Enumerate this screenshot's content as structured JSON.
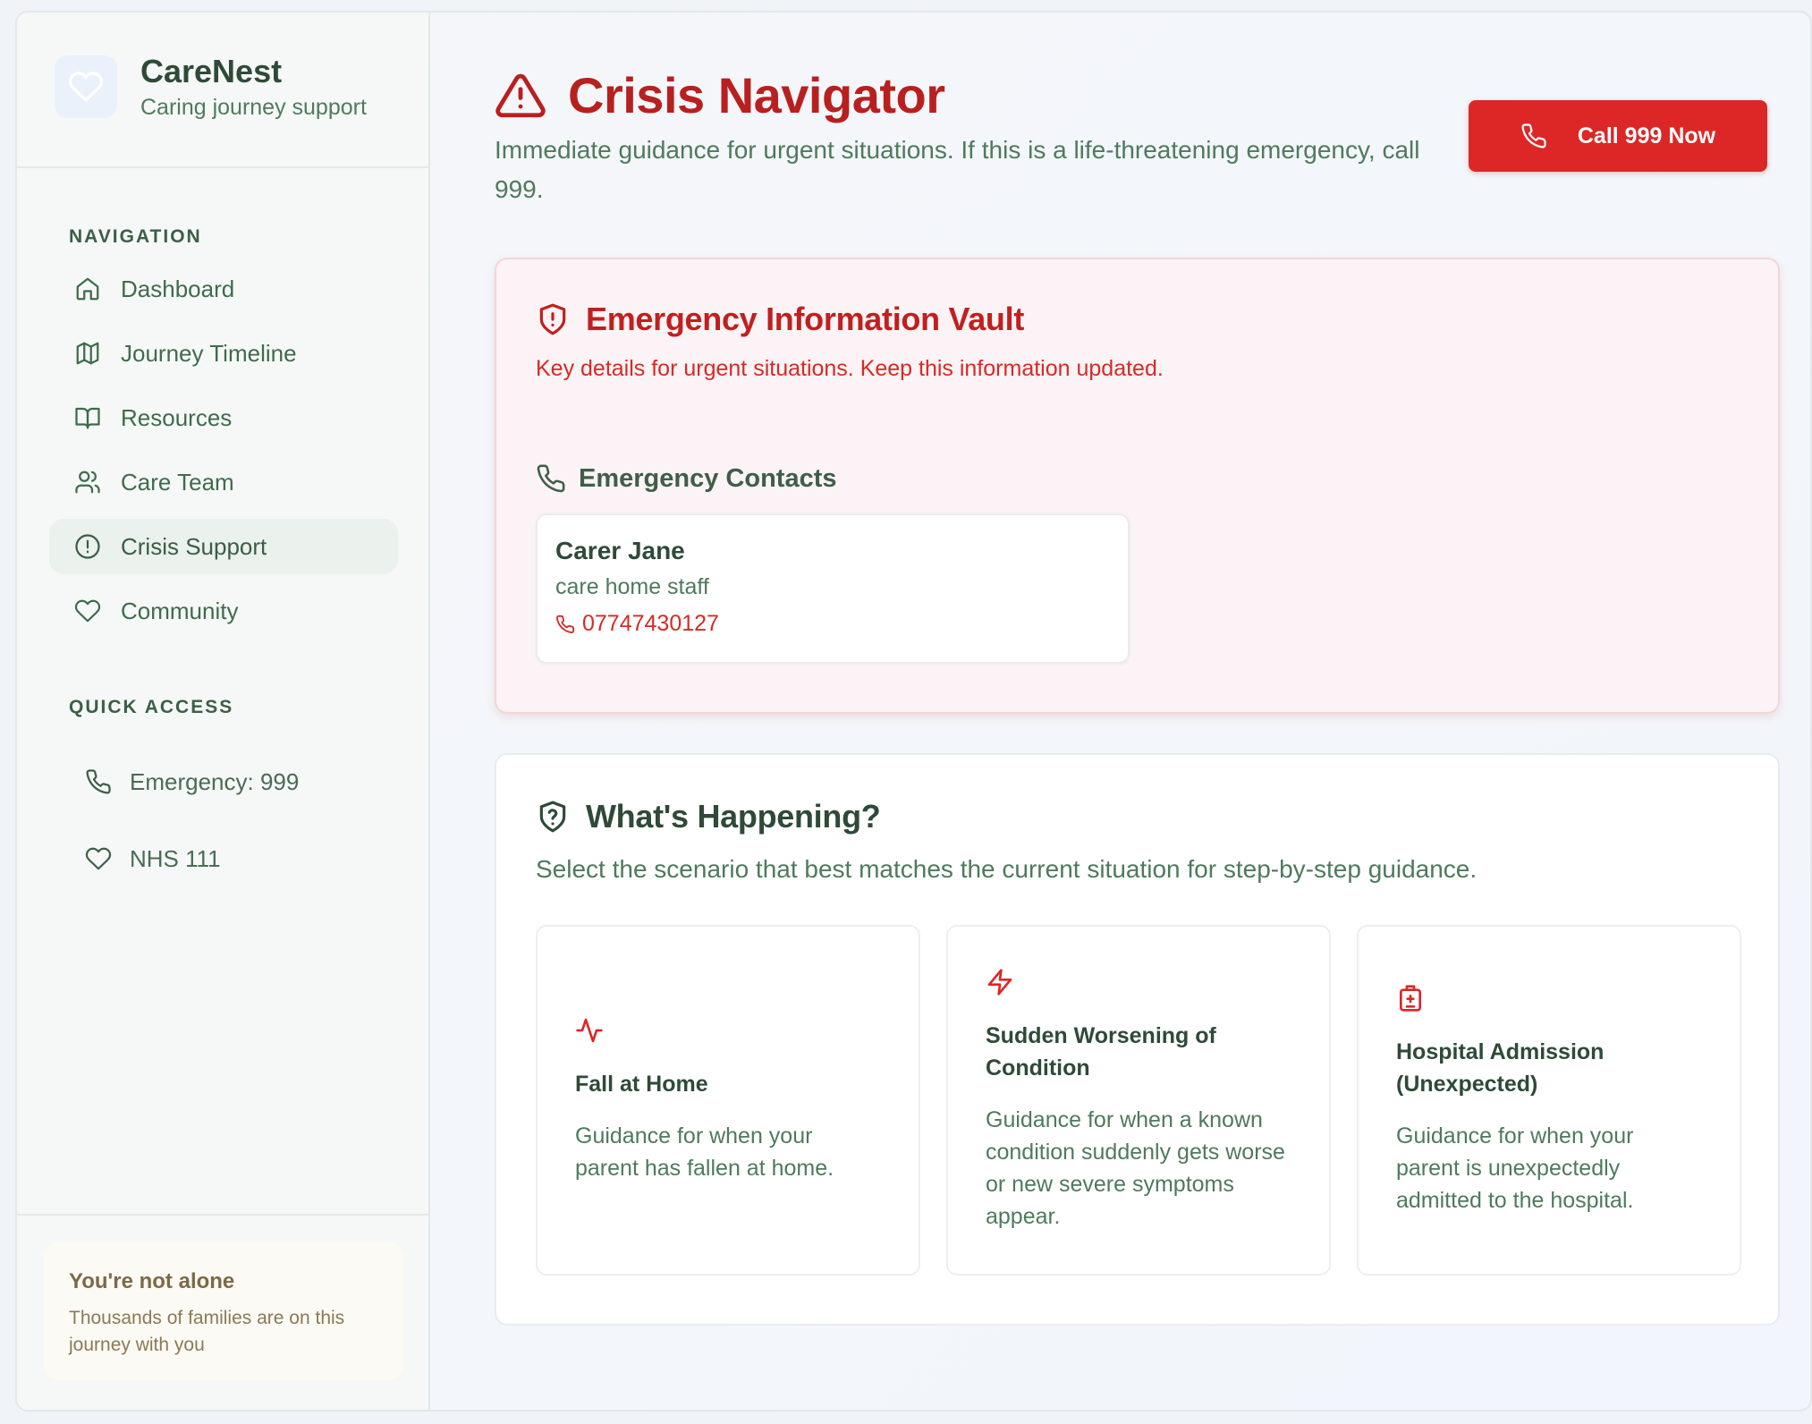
{
  "brand": {
    "name": "CareNest",
    "tagline": "Caring journey support"
  },
  "sidebar": {
    "nav_label": "NAVIGATION",
    "items": [
      {
        "label": "Dashboard",
        "icon": "home-icon"
      },
      {
        "label": "Journey Timeline",
        "icon": "map-icon"
      },
      {
        "label": "Resources",
        "icon": "book-icon"
      },
      {
        "label": "Care Team",
        "icon": "users-icon"
      },
      {
        "label": "Crisis Support",
        "icon": "alert-circle-icon",
        "active": true
      },
      {
        "label": "Community",
        "icon": "heart-icon"
      }
    ],
    "quick_label": "QUICK ACCESS",
    "quick": [
      {
        "label": "Emergency: 999",
        "icon": "phone-icon"
      },
      {
        "label": "NHS 111",
        "icon": "heart-icon"
      }
    ],
    "support": {
      "title": "You're not alone",
      "text": "Thousands of families are on this journey with you"
    }
  },
  "header": {
    "title": "Crisis Navigator",
    "subtitle": "Immediate guidance for urgent situations. If this is a life-threatening emergency, call 999.",
    "call_button": "Call 999 Now"
  },
  "vault": {
    "title": "Emergency Information Vault",
    "subtitle": "Key details for urgent situations. Keep this information updated.",
    "contacts_title": "Emergency Contacts",
    "contacts": [
      {
        "name": "Carer Jane",
        "role": "care home staff",
        "phone": "07747430127"
      }
    ]
  },
  "happening": {
    "title": "What's Happening?",
    "subtitle": "Select the scenario that best matches the current situation for step-by-step guidance.",
    "scenarios": [
      {
        "icon": "activity-icon",
        "title": "Fall at Home",
        "desc": "Guidance for when your parent has fallen at home."
      },
      {
        "icon": "zap-icon",
        "title": "Sudden Worsening of Condition",
        "desc": "Guidance for when a known condition suddenly gets worse or new severe symptoms appear."
      },
      {
        "icon": "hospital-icon",
        "title": "Hospital Admission (Unexpected)",
        "desc": "Guidance for when your parent is unexpectedly admitted to the hospital."
      }
    ]
  },
  "colors": {
    "primary_green": "#3f6b4c",
    "danger_red": "#dc2726",
    "danger_text": "#c0201f"
  }
}
